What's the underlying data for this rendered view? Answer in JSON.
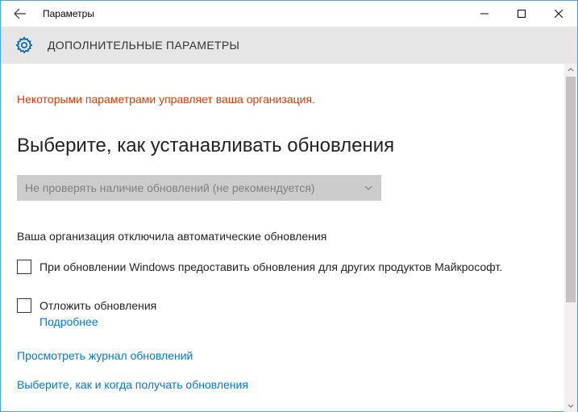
{
  "window": {
    "title": "Параметры"
  },
  "header": {
    "title": "ДОПОЛНИТЕЛЬНЫЕ ПАРАМЕТРЫ"
  },
  "content": {
    "org_notice": "Некоторыми параметрами управляет ваша организация.",
    "section_title": "Выберите, как устанавливать обновления",
    "dropdown_value": "Не проверять наличие обновлений (не рекомендуется)",
    "status_text": "Ваша организация отключила автоматические обновления",
    "checkbox1_label": "При обновлении Windows предоставить обновления для других продуктов Майкрософт.",
    "checkbox2_label": "Отложить обновления",
    "more_link": "Подробнее",
    "link_history": "Просмотреть журнал обновлений",
    "link_choose": "Выберите, как и когда получать обновления"
  }
}
